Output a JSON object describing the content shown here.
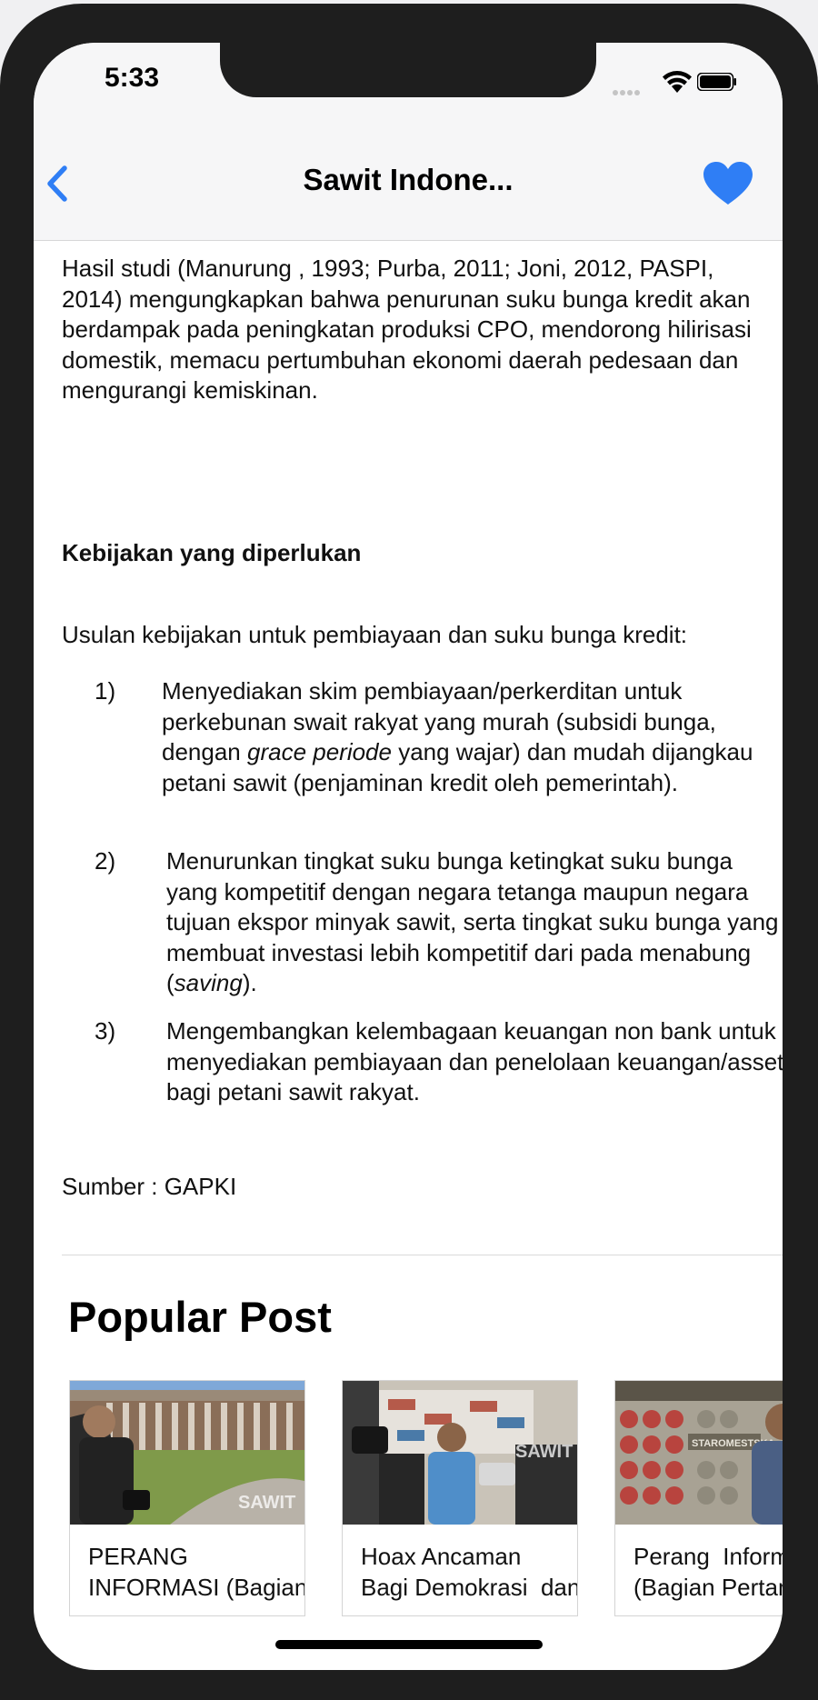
{
  "status_bar": {
    "time": "5:33"
  },
  "nav": {
    "title": "Sawit Indone..."
  },
  "article": {
    "intro": "Hasil studi (Manurung , 1993; Purba, 2011; Joni, 2012, PASPI, 2014) mengungkapkan bahwa penurunan suku bunga kredit akan berdampak pada peningkatan produksi CPO, mendorong hilirisasi domestik, memacu pertumbuhan ekonomi daerah pedesaan dan mengurangi kemiskinan.",
    "heading": "Kebijakan yang diperlukan",
    "lead": "Usulan kebijakan untuk pembiayaan dan suku bunga kredit:",
    "items": [
      {
        "num": "1)",
        "a": "Menyediakan skim pembiayaan/perkerditan untuk perkebunan swait rakyat yang murah (subsidi bunga, dengan ",
        "em": "grace periode",
        "b": " yang wajar) dan mudah dijangkau petani sawit (penjaminan kredit oleh pemerintah)."
      },
      {
        "num": "2)",
        "a": "Menurunkan tingkat suku bunga ketingkat suku bunga yang kompetitif dengan negara tetanga maupun negara tujuan ekspor minyak sawit, serta tingkat suku bunga yang membuat investasi lebih kompetitif dari pada menabung (",
        "em": "saving",
        "b": ")."
      },
      {
        "num": "3)",
        "a": "Mengembangkan kelembagaan keuangan non bank untuk menyediakan pembiayaan dan penelolaan keuangan/asset bagi petani sawit rakyat.",
        "em": "",
        "b": ""
      }
    ],
    "source": "Sumber : GAPKI"
  },
  "popular": {
    "title": "Popular Post",
    "posts": [
      {
        "title": "PERANG\nINFORMASI (Bagian",
        "watermark": "SAWIT"
      },
      {
        "title": "Hoax Ancaman\nBagi Demokrasi  dan",
        "watermark": "SAWIT"
      },
      {
        "title": "Perang  Informasi\n(Bagian Pertama)",
        "watermark": "STAROMESTSKA"
      }
    ]
  },
  "colors": {
    "accent": "#2f7ef5",
    "screen": "#ffffff",
    "bezel": "#1e1e1e"
  },
  "icons": {
    "back": "chevron-left-icon",
    "favorite": "heart-icon",
    "wifi": "wifi-icon",
    "battery": "battery-icon",
    "signal": "signal-icon"
  }
}
